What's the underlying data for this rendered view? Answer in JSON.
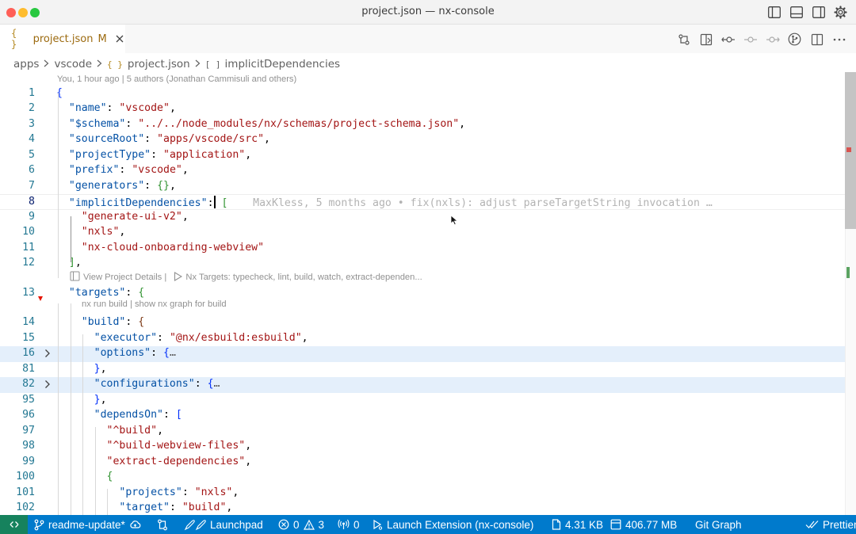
{
  "window": {
    "title": "project.json — nx-console"
  },
  "tab": {
    "icon_text": "{ }",
    "filename": "project.json",
    "modified": "M"
  },
  "breadcrumbs": {
    "items": [
      "apps",
      "vscode",
      "project.json",
      "implicitDependencies"
    ],
    "json_icon_text": "{ }",
    "array_icon_text": "[ ]"
  },
  "blame_header": "You, 1 hour ago | 5 authors (Jonathan Cammisuli and others)",
  "inline_blame": "MaxKless, 5 months ago • fix(nxls): adjust parseTargetString invocation …",
  "codelens": {
    "project_details": "View Project Details |",
    "nx_targets": "Nx Targets: typecheck, lint, build, watch, extract-dependen...",
    "build_lens": "nx run build | show nx graph for build"
  },
  "lines": [
    {
      "n": "1",
      "tokens": [
        {
          "t": "{",
          "c": "b1"
        }
      ]
    },
    {
      "n": "2",
      "tokens": [
        {
          "t": "  "
        },
        {
          "t": "\"name\"",
          "c": "k"
        },
        {
          "t": ": ",
          "c": "p"
        },
        {
          "t": "\"vscode\"",
          "c": "s"
        },
        {
          "t": ",",
          "c": "p"
        }
      ]
    },
    {
      "n": "3",
      "tokens": [
        {
          "t": "  "
        },
        {
          "t": "\"$schema\"",
          "c": "k"
        },
        {
          "t": ": ",
          "c": "p"
        },
        {
          "t": "\"../../node_modules/nx/schemas/project-schema.json\"",
          "c": "s"
        },
        {
          "t": ",",
          "c": "p"
        }
      ]
    },
    {
      "n": "4",
      "tokens": [
        {
          "t": "  "
        },
        {
          "t": "\"sourceRoot\"",
          "c": "k"
        },
        {
          "t": ": ",
          "c": "p"
        },
        {
          "t": "\"apps/vscode/src\"",
          "c": "s"
        },
        {
          "t": ",",
          "c": "p"
        }
      ]
    },
    {
      "n": "5",
      "tokens": [
        {
          "t": "  "
        },
        {
          "t": "\"projectType\"",
          "c": "k"
        },
        {
          "t": ": ",
          "c": "p"
        },
        {
          "t": "\"application\"",
          "c": "s"
        },
        {
          "t": ",",
          "c": "p"
        }
      ]
    },
    {
      "n": "6",
      "tokens": [
        {
          "t": "  "
        },
        {
          "t": "\"prefix\"",
          "c": "k"
        },
        {
          "t": ": ",
          "c": "p"
        },
        {
          "t": "\"vscode\"",
          "c": "s"
        },
        {
          "t": ",",
          "c": "p"
        }
      ]
    },
    {
      "n": "7",
      "tokens": [
        {
          "t": "  "
        },
        {
          "t": "\"generators\"",
          "c": "k"
        },
        {
          "t": ": ",
          "c": "p"
        },
        {
          "t": "{}",
          "c": "b2"
        },
        {
          "t": ",",
          "c": "p"
        }
      ]
    },
    {
      "n": "8",
      "tokens": [
        {
          "t": "  "
        },
        {
          "t": "\"implicitDependencies\"",
          "c": "k"
        },
        {
          "t": ":",
          "c": "p"
        },
        {
          "cursor": true
        },
        {
          "t": " "
        },
        {
          "t": "[",
          "c": "b2"
        }
      ]
    },
    {
      "n": "9",
      "tokens": [
        {
          "t": "    "
        },
        {
          "t": "\"generate-ui-v2\"",
          "c": "s"
        },
        {
          "t": ",",
          "c": "p"
        }
      ]
    },
    {
      "n": "10",
      "tokens": [
        {
          "t": "    "
        },
        {
          "t": "\"nxls\"",
          "c": "s"
        },
        {
          "t": ",",
          "c": "p"
        }
      ]
    },
    {
      "n": "11",
      "tokens": [
        {
          "t": "    "
        },
        {
          "t": "\"nx-cloud-onboarding-webview\"",
          "c": "s"
        }
      ]
    },
    {
      "n": "12",
      "tokens": [
        {
          "t": "  "
        },
        {
          "t": "]",
          "c": "b2"
        },
        {
          "t": ",",
          "c": "p"
        }
      ]
    },
    {
      "n": "13",
      "tokens": [
        {
          "t": "  "
        },
        {
          "t": "\"targets\"",
          "c": "k"
        },
        {
          "t": ": ",
          "c": "p"
        },
        {
          "t": "{",
          "c": "b2"
        }
      ]
    },
    {
      "n": "14",
      "tokens": [
        {
          "t": "    "
        },
        {
          "t": "\"build\"",
          "c": "k"
        },
        {
          "t": ": ",
          "c": "p"
        },
        {
          "t": "{",
          "c": "b3"
        }
      ]
    },
    {
      "n": "15",
      "tokens": [
        {
          "t": "      "
        },
        {
          "t": "\"executor\"",
          "c": "k"
        },
        {
          "t": ": ",
          "c": "p"
        },
        {
          "t": "\"@nx/esbuild:esbuild\"",
          "c": "s"
        },
        {
          "t": ",",
          "c": "p"
        }
      ]
    },
    {
      "n": "16",
      "tokens": [
        {
          "t": "      "
        },
        {
          "t": "\"options\"",
          "c": "k"
        },
        {
          "t": ": ",
          "c": "p"
        },
        {
          "t": "{",
          "c": "b1"
        },
        {
          "t": "…",
          "c": "ell"
        }
      ]
    },
    {
      "n": "81",
      "tokens": [
        {
          "t": "      "
        },
        {
          "t": "}",
          "c": "b1"
        },
        {
          "t": ",",
          "c": "p"
        }
      ]
    },
    {
      "n": "82",
      "tokens": [
        {
          "t": "      "
        },
        {
          "t": "\"configurations\"",
          "c": "k"
        },
        {
          "t": ": ",
          "c": "p"
        },
        {
          "t": "{",
          "c": "b1"
        },
        {
          "t": "…",
          "c": "ell"
        }
      ]
    },
    {
      "n": "95",
      "tokens": [
        {
          "t": "      "
        },
        {
          "t": "}",
          "c": "b1"
        },
        {
          "t": ",",
          "c": "p"
        }
      ]
    },
    {
      "n": "96",
      "tokens": [
        {
          "t": "      "
        },
        {
          "t": "\"dependsOn\"",
          "c": "k"
        },
        {
          "t": ": ",
          "c": "p"
        },
        {
          "t": "[",
          "c": "b1"
        }
      ]
    },
    {
      "n": "97",
      "tokens": [
        {
          "t": "        "
        },
        {
          "t": "\"^build\"",
          "c": "s"
        },
        {
          "t": ",",
          "c": "p"
        }
      ]
    },
    {
      "n": "98",
      "tokens": [
        {
          "t": "        "
        },
        {
          "t": "\"^build-webview-files\"",
          "c": "s"
        },
        {
          "t": ",",
          "c": "p"
        }
      ]
    },
    {
      "n": "99",
      "tokens": [
        {
          "t": "        "
        },
        {
          "t": "\"extract-dependencies\"",
          "c": "s"
        },
        {
          "t": ",",
          "c": "p"
        }
      ]
    },
    {
      "n": "100",
      "tokens": [
        {
          "t": "        "
        },
        {
          "t": "{",
          "c": "b2"
        }
      ]
    },
    {
      "n": "101",
      "tokens": [
        {
          "t": "          "
        },
        {
          "t": "\"projects\"",
          "c": "k"
        },
        {
          "t": ": ",
          "c": "p"
        },
        {
          "t": "\"nxls\"",
          "c": "s"
        },
        {
          "t": ",",
          "c": "p"
        }
      ]
    },
    {
      "n": "102",
      "tokens": [
        {
          "t": "          "
        },
        {
          "t": "\"target\"",
          "c": "k"
        },
        {
          "t": ": ",
          "c": "p"
        },
        {
          "t": "\"build\"",
          "c": "s"
        },
        {
          "t": ",",
          "c": "p"
        }
      ]
    }
  ],
  "statusbar": {
    "branch": "readme-update*",
    "launchpad": "Launchpad",
    "errors": "0",
    "warnings": "3",
    "ports": "0",
    "launch": "Launch Extension (nx-console)",
    "file_size": "4.31 KB",
    "memory": "406.77 MB",
    "git_graph": "Git Graph",
    "prettier": "Prettier"
  },
  "colors": {
    "statusbar": "#007acc",
    "remote": "#16825d",
    "json_key": "#0451a5",
    "json_string": "#a31515",
    "line_number": "#237893",
    "fold_highlight": "#e4effb"
  }
}
